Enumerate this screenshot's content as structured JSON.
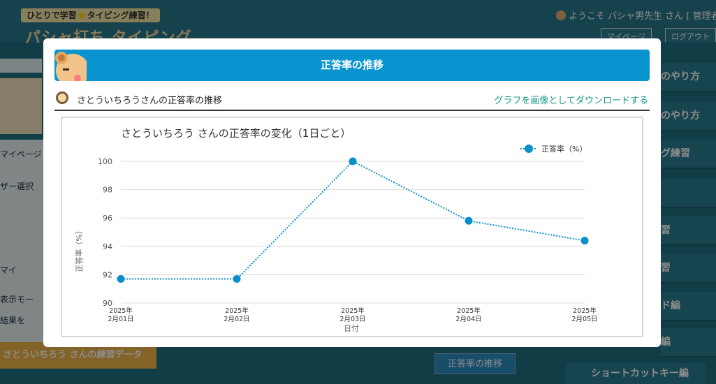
{
  "background": {
    "tagline": "ひとりで学習⭐タイピング練習！",
    "logo": "パシャ打ち タイピング",
    "welcome": "ようこそ パシャ男先生 さん [ 管理者",
    "top_buttons": [
      "マイページ",
      "ログアウト"
    ],
    "left_labels": [
      "マイページ",
      "ザー選択",
      "マイ",
      "表示モー",
      "結果を"
    ],
    "right_buttons": [
      "のやり方",
      "のやり方",
      "グ練習",
      "",
      "習",
      "習",
      "ド編",
      "編"
    ],
    "bottom_tag": "さとういちろう さんの練習データ",
    "bottom_button": "正答率の推移",
    "bottom_right": "ショートカットキー編"
  },
  "modal": {
    "title": "正答率の推移",
    "subtitle": "さとういちろうさんの正答率の推移",
    "download_link": "グラフを画像としてダウンロードする"
  },
  "colors": {
    "accent": "#0a94cf",
    "link": "#1a9a8a",
    "series": "#0a8fc9"
  },
  "chart_data": {
    "type": "line",
    "title": "さとういちろう さんの正答率の変化（1日ごと）",
    "xlabel": "日付",
    "ylabel": "正答率（%）",
    "categories": [
      [
        "2025年",
        "2月01日"
      ],
      [
        "2025年",
        "2月02日"
      ],
      [
        "2025年",
        "2月03日"
      ],
      [
        "2025年",
        "2月04日"
      ],
      [
        "2025年",
        "2月05日"
      ]
    ],
    "series": [
      {
        "name": "正答率（%）",
        "values": [
          91.7,
          91.7,
          100,
          95.8,
          94.4
        ]
      }
    ],
    "ylim": [
      90,
      100
    ],
    "yticks": [
      90,
      92,
      94,
      96,
      98,
      100
    ],
    "grid": true,
    "legend_position": "top-right"
  }
}
